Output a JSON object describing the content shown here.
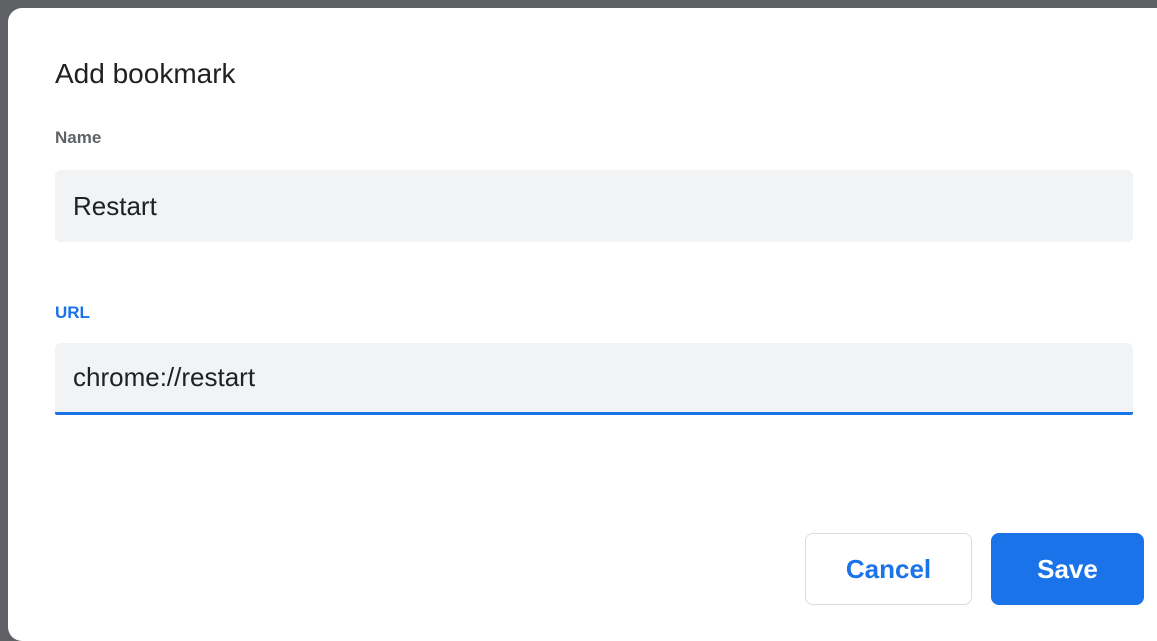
{
  "dialog": {
    "title": "Add bookmark",
    "name_label": "Name",
    "name_value": "Restart",
    "url_label": "URL",
    "url_value": "chrome://restart",
    "cancel_label": "Cancel",
    "save_label": "Save"
  },
  "colors": {
    "accent": "#1a73e8",
    "field_background": "#f1f3f4",
    "backdrop": "#5f6064"
  }
}
